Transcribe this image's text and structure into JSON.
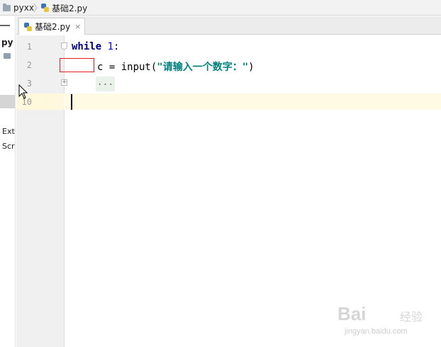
{
  "breadcrumb": {
    "project": "pyxx",
    "file": "基础2.py"
  },
  "project_panel": {
    "root_label": "py",
    "item_ext": "Ext",
    "item_scr": "Scr"
  },
  "editor": {
    "active_tab": "基础2.py",
    "tab_close_glyph": "×",
    "line_numbers": [
      "1",
      "2",
      "3",
      "10"
    ],
    "lines": {
      "l1_keyword": "while",
      "l1_number": "1",
      "l1_colon": ":",
      "l2_var": "c = input(",
      "l2_string": "\"请输入一个数字：\"",
      "l2_close": ")",
      "l3_folded": "..."
    }
  },
  "watermark": {
    "logo": "Bai",
    "logo_cn": "经验",
    "url": "jingyan.baidu.com"
  },
  "colors": {
    "keyword": "#000080",
    "number": "#0000ff",
    "string": "#008080",
    "current_line": "#fffae3",
    "highlight_box": "#e02020"
  }
}
